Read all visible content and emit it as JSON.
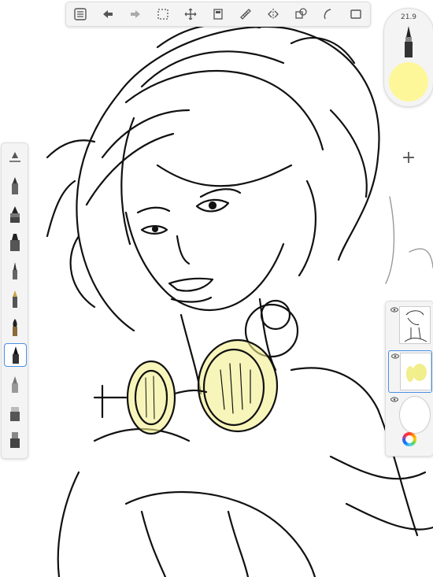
{
  "toolbar": {
    "items": [
      {
        "name": "gallery-list-icon"
      },
      {
        "name": "undo-icon"
      },
      {
        "name": "redo-icon"
      },
      {
        "name": "selection-icon"
      },
      {
        "name": "transform-icon"
      },
      {
        "name": "layer-copy-icon"
      },
      {
        "name": "ruler-icon"
      },
      {
        "name": "symmetry-icon"
      },
      {
        "name": "shapes-icon"
      },
      {
        "name": "curve-icon"
      },
      {
        "name": "fullscreen-icon"
      }
    ]
  },
  "brush_puck": {
    "size_label": "21.9",
    "color": "#fdf79a"
  },
  "brushes": [
    {
      "name": "brush-size-slider-icon"
    },
    {
      "name": "pencil-icon"
    },
    {
      "name": "ink-pen-icon"
    },
    {
      "name": "marker-icon"
    },
    {
      "name": "ballpoint-icon"
    },
    {
      "name": "fountain-pen-icon"
    },
    {
      "name": "paintbrush-icon"
    },
    {
      "name": "fineliner-icon",
      "selected": true
    },
    {
      "name": "airbrush-icon"
    },
    {
      "name": "eraser-icon"
    },
    {
      "name": "smudge-icon"
    }
  ],
  "layers": {
    "add_label": "+",
    "items": [
      {
        "name": "layer-sketch"
      },
      {
        "name": "layer-highlight",
        "selected": true
      },
      {
        "name": "layer-background"
      }
    ]
  },
  "colors": {
    "accent": "#4a90e2",
    "highlight": "#f1ee8c"
  }
}
